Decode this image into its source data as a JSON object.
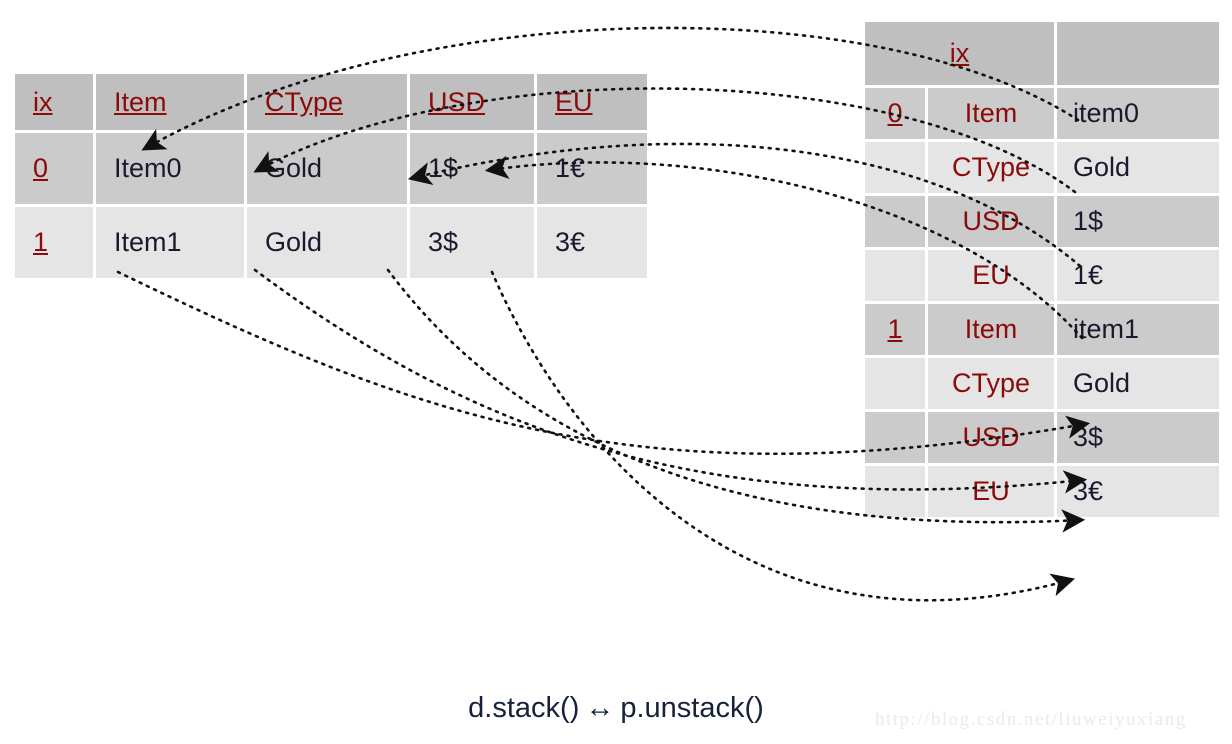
{
  "caption": {
    "left_call": "d.stack()",
    "arrow_glyph": "↔",
    "right_call": "p.unstack()"
  },
  "watermark": {
    "text": "http://blog.csdn.net/liuweiyuxiang"
  },
  "colors": {
    "header_bg": "#bfbfbf",
    "row_dark_bg": "#cbcbcb",
    "row_light_bg": "#e5e5e5",
    "header_text": "#8b0a0a",
    "value_text": "#1a1a2e",
    "page_bg": "#ffffff",
    "arrow_stroke": "#111111"
  },
  "left_table": {
    "name": "pivoted-dataframe",
    "headers": [
      "ix",
      "Item",
      "CType",
      "USD",
      "EU"
    ],
    "rows": [
      {
        "ix": "0",
        "Item": "Item0",
        "CType": "Gold",
        "USD": "1$",
        "EU": "1€"
      },
      {
        "ix": "1",
        "Item": "Item1",
        "CType": "Gold",
        "USD": "3$",
        "EU": "3€"
      }
    ]
  },
  "right_table": {
    "name": "stacked-series",
    "headers": [
      "ix",
      ""
    ],
    "rows": [
      {
        "ix": "0",
        "label": "Item",
        "value": "item0"
      },
      {
        "ix": "",
        "label": "CType",
        "value": "Gold"
      },
      {
        "ix": "",
        "label": "USD",
        "value": "1$"
      },
      {
        "ix": "",
        "label": "EU",
        "value": "1€"
      },
      {
        "ix": "1",
        "label": "Item",
        "value": "item1"
      },
      {
        "ix": "",
        "label": "CType",
        "value": "Gold"
      },
      {
        "ix": "",
        "label": "USD",
        "value": "3$"
      },
      {
        "ix": "",
        "label": "EU",
        "value": "3€"
      }
    ]
  },
  "mappings": [
    {
      "from": "right.0.Item.value",
      "to": "left.row0.Item",
      "direction": "right-to-left"
    },
    {
      "from": "right.0.CType.value",
      "to": "left.row0.CType",
      "direction": "right-to-left"
    },
    {
      "from": "right.0.USD.value",
      "to": "left.row0.USD",
      "direction": "right-to-left"
    },
    {
      "from": "right.0.EU.value",
      "to": "left.row0.EU",
      "direction": "right-to-left"
    },
    {
      "from": "left.row1.Item",
      "to": "right.1.Item.value",
      "direction": "left-to-right"
    },
    {
      "from": "left.row1.CType",
      "to": "right.1.CType.value",
      "direction": "left-to-right"
    },
    {
      "from": "left.row1.USD",
      "to": "right.1.USD.value",
      "direction": "left-to-right"
    },
    {
      "from": "left.row1.EU",
      "to": "right.1.EU.value",
      "direction": "left-to-right"
    }
  ]
}
